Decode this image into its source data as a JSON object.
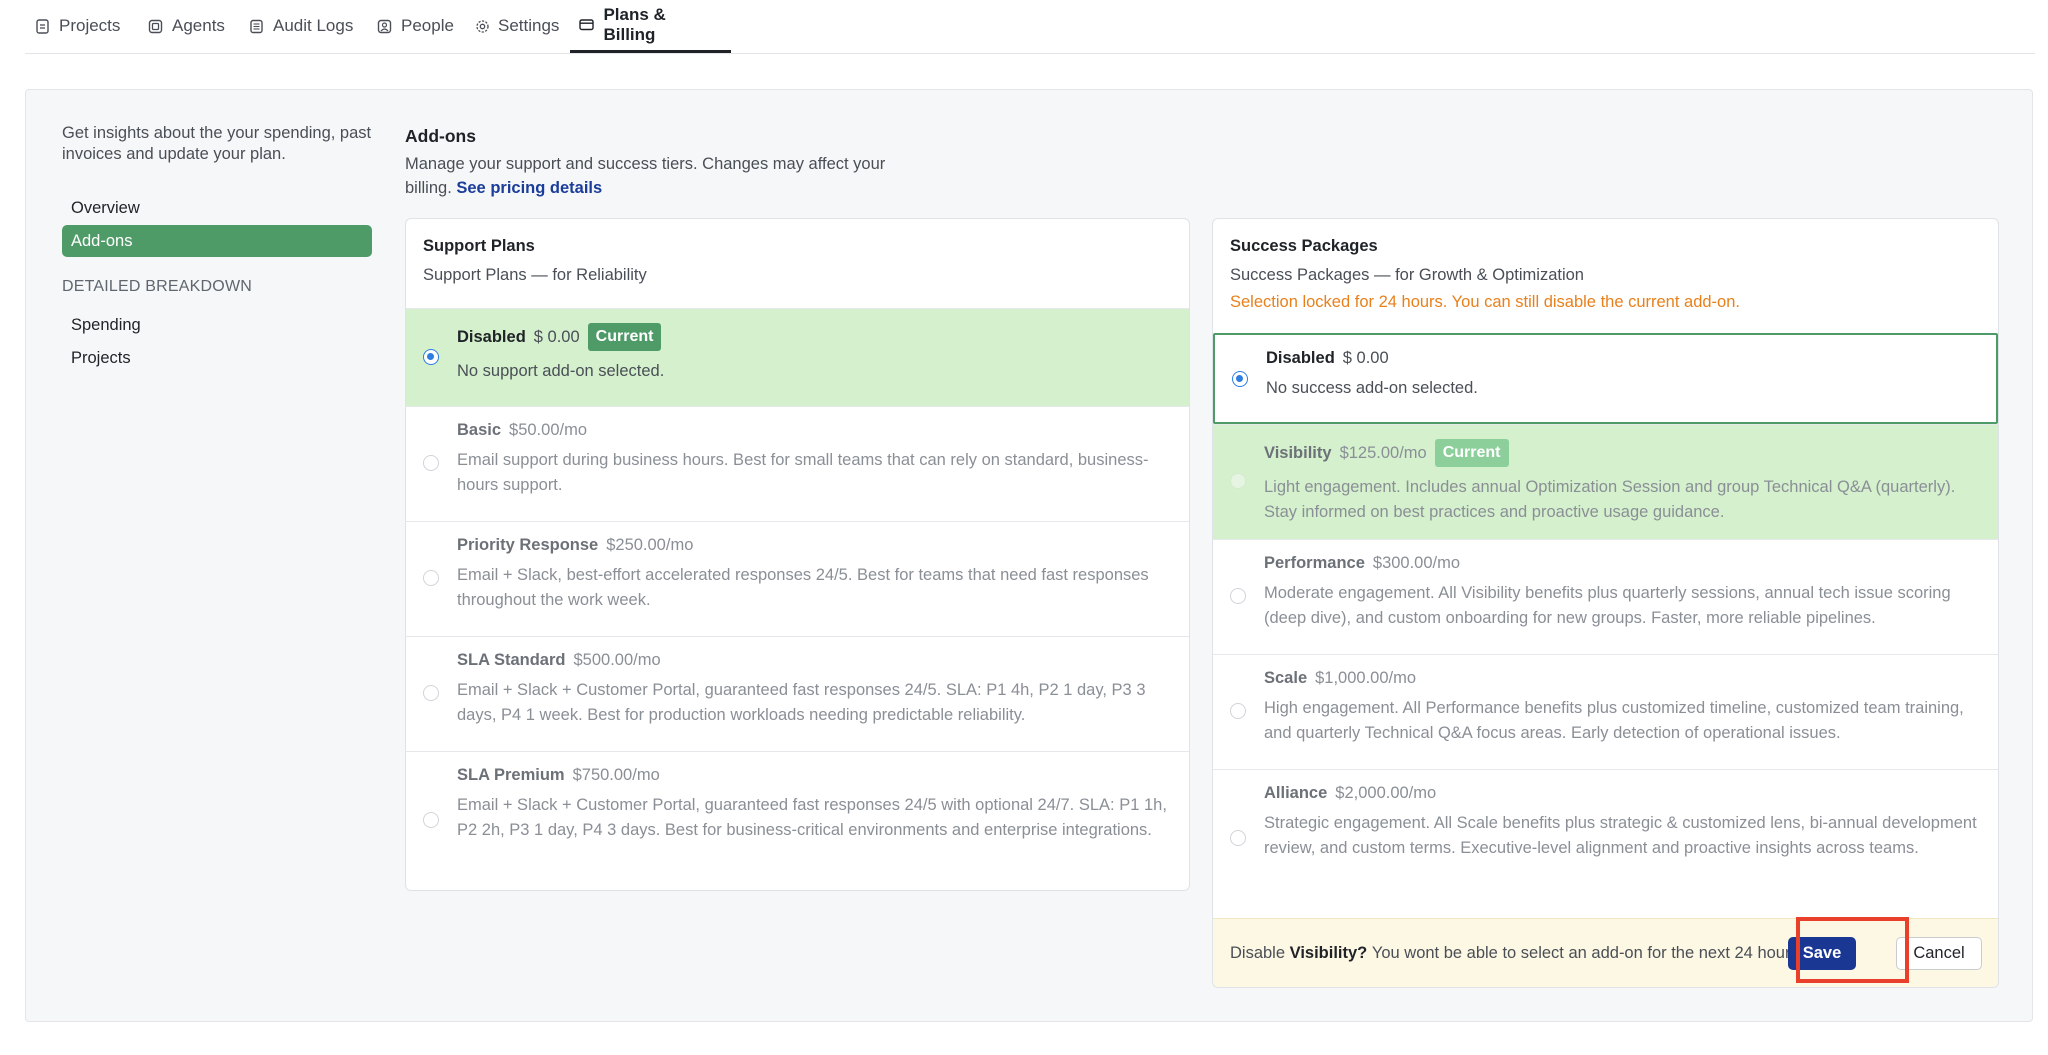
{
  "tabs": [
    {
      "label": "Projects",
      "icon": "document-icon"
    },
    {
      "label": "Agents",
      "icon": "agent-icon"
    },
    {
      "label": "Audit Logs",
      "icon": "log-icon"
    },
    {
      "label": "People",
      "icon": "person-icon"
    },
    {
      "label": "Settings",
      "icon": "gear-icon"
    },
    {
      "label": "Plans & Billing",
      "icon": "credit-card-icon",
      "active": true
    }
  ],
  "sidebar": {
    "description": "Get insights about the your spending, past invoices and update your plan.",
    "items": [
      {
        "label": "Overview"
      },
      {
        "label": "Add-ons",
        "active": true
      }
    ],
    "breakdown_heading": "DETAILED BREAKDOWN",
    "breakdown_items": [
      {
        "label": "Spending"
      },
      {
        "label": "Projects"
      }
    ]
  },
  "content": {
    "title": "Add-ons",
    "description": "Manage your support and success tiers. Changes may affect your billing.",
    "pricing_link": "See pricing details"
  },
  "support": {
    "title": "Support Plans",
    "subtitle": "Support Plans — for Reliability",
    "options": [
      {
        "name": "Disabled",
        "price": "$ 0.00",
        "badge": "Current",
        "desc": "No support add-on selected.",
        "selected": true
      },
      {
        "name": "Basic",
        "price": "$50.00/mo",
        "desc": "Email support during business hours. Best for small teams that can rely on standard, business-hours support."
      },
      {
        "name": "Priority Response",
        "price": "$250.00/mo",
        "desc": "Email + Slack, best-effort accelerated responses 24/5. Best for teams that need fast responses throughout the work week."
      },
      {
        "name": "SLA Standard",
        "price": "$500.00/mo",
        "desc": "Email + Slack + Customer Portal, guaranteed fast responses 24/5. SLA: P1 4h, P2 1 day, P3 3 days, P4 1 week. Best for production workloads needing predictable reliability."
      },
      {
        "name": "SLA Premium",
        "price": "$750.00/mo",
        "desc": "Email + Slack + Customer Portal, guaranteed fast responses 24/5 with optional 24/7. SLA: P1 1h, P2 2h, P3 1 day, P4 3 days. Best for business-critical environments and enterprise integrations."
      }
    ]
  },
  "success": {
    "title": "Success Packages",
    "subtitle": "Success Packages — for Growth & Optimization",
    "warning": "Selection locked for 24 hours. You can still disable the current add-on.",
    "options": [
      {
        "name": "Disabled",
        "price": "$ 0.00",
        "desc": "No success add-on selected.",
        "selected": true
      },
      {
        "name": "Visibility",
        "price": "$125.00/mo",
        "badge": "Current",
        "desc": "Light engagement. Includes annual Optimization Session and group Technical Q&A (quarterly). Stay informed on best practices and proactive usage guidance."
      },
      {
        "name": "Performance",
        "price": "$300.00/mo",
        "desc": "Moderate engagement. All Visibility benefits plus quarterly sessions, annual tech issue scoring (deep dive), and custom onboarding for new groups. Faster, more reliable pipelines."
      },
      {
        "name": "Scale",
        "price": "$1,000.00/mo",
        "desc": "High engagement. All Performance benefits plus customized timeline, customized team training, and quarterly Technical Q&A focus areas. Early detection of operational issues."
      },
      {
        "name": "Alliance",
        "price": "$2,000.00/mo",
        "desc": "Strategic engagement. All Scale benefits plus strategic & customized lens, bi-annual development review, and custom terms. Executive-level alignment and proactive insights across teams."
      }
    ],
    "confirm": {
      "prefix": "Disable",
      "item": "Visibility?",
      "message": "You wont be able to select an add-on for the next 24 hours.",
      "save": "Save",
      "cancel": "Cancel"
    }
  },
  "colors": {
    "accent_green": "#4f9b68",
    "current_bg": "#d5f0cd",
    "primary_button": "#1a3794",
    "warning": "#e8801c",
    "highlight": "#e8402a"
  }
}
